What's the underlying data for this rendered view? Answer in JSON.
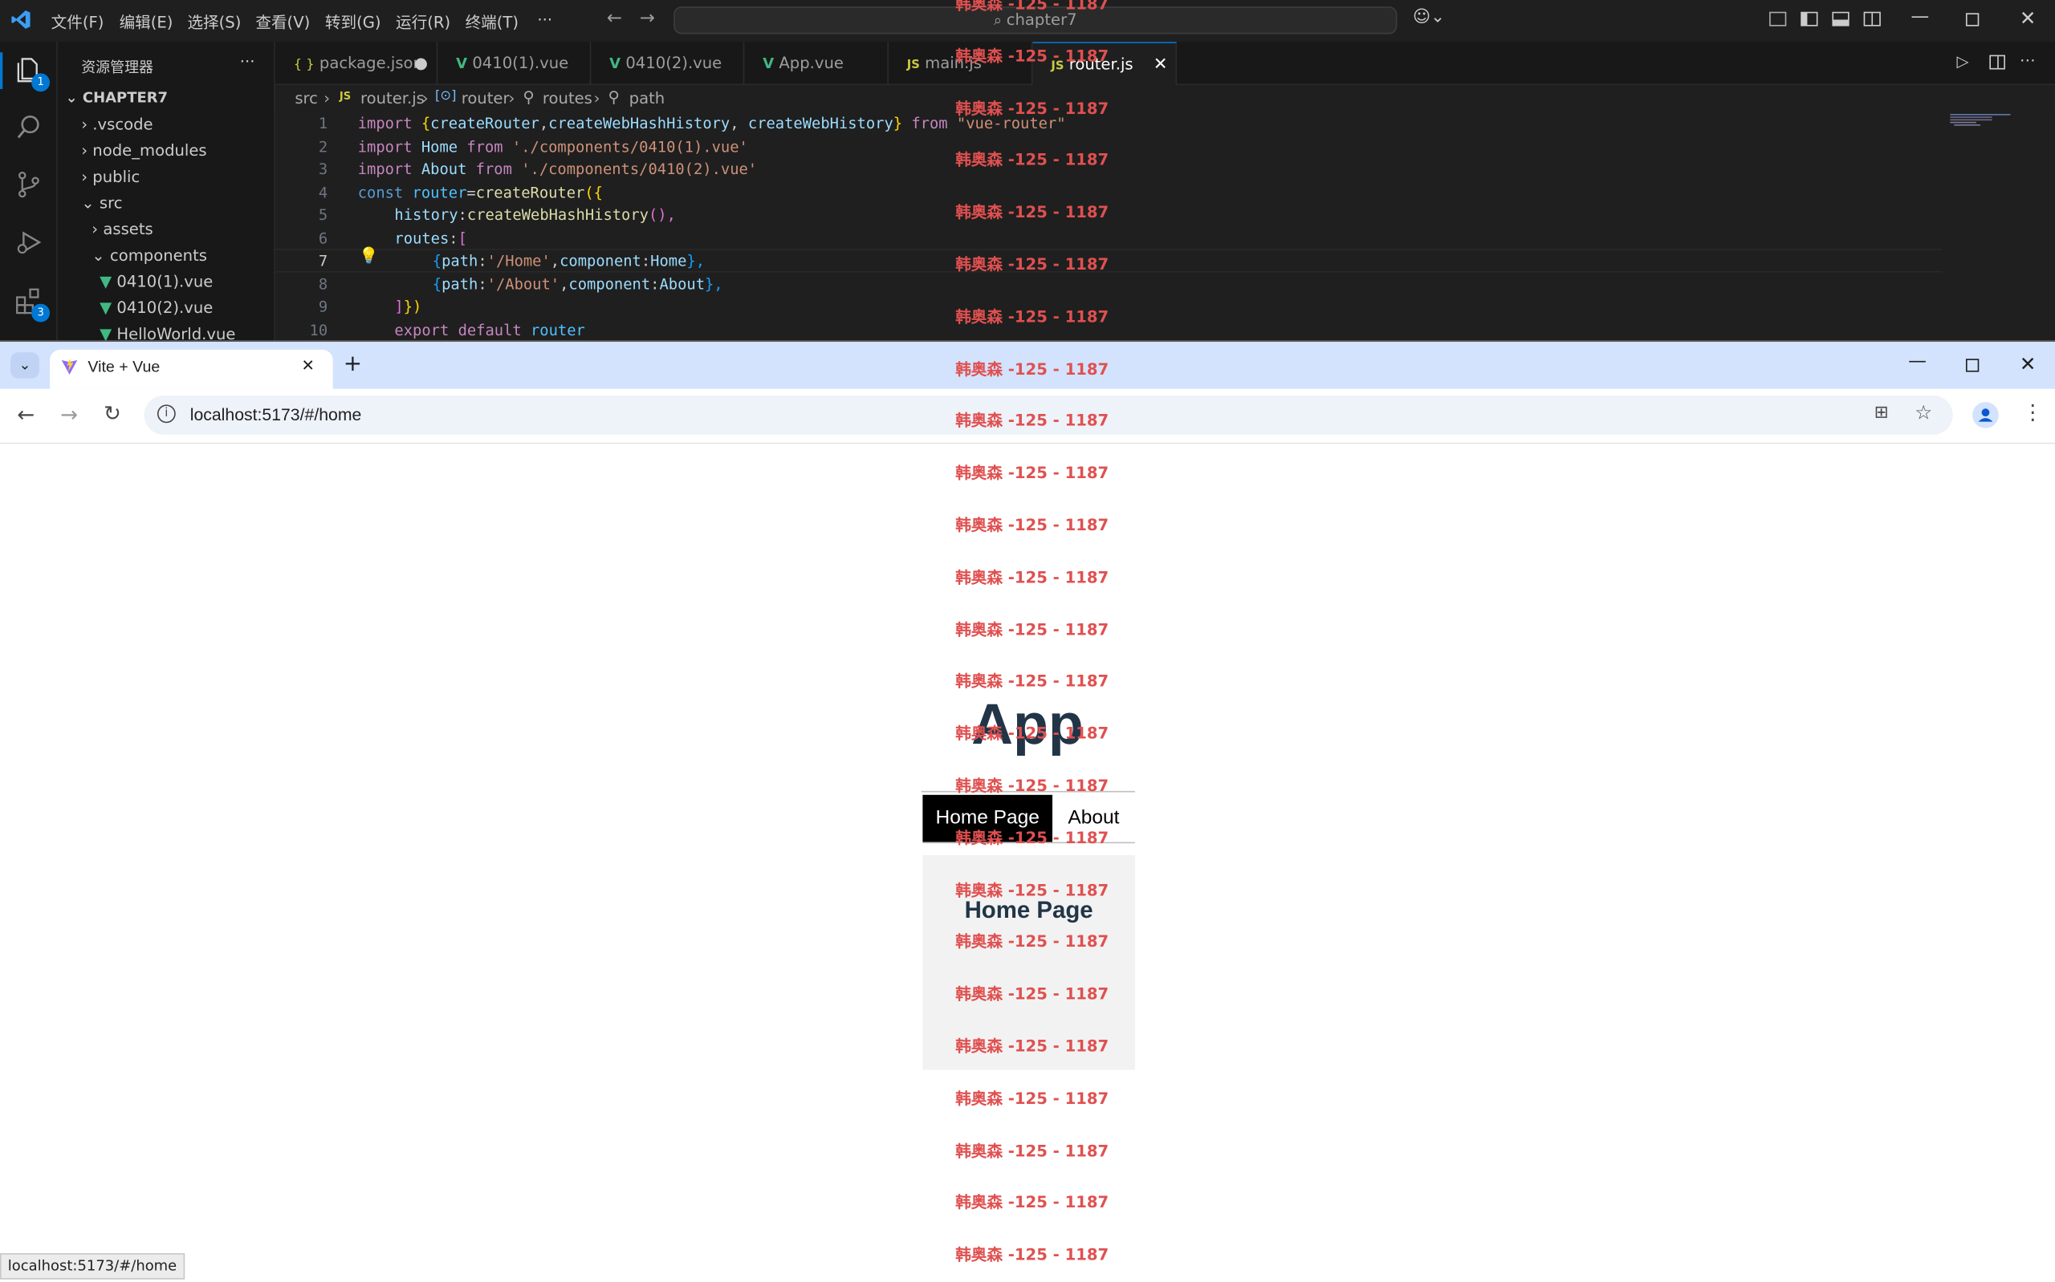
{
  "vscode": {
    "menu": [
      "文件(F)",
      "编辑(E)",
      "选择(S)",
      "查看(V)",
      "转到(G)",
      "运行(R)",
      "终端(T)",
      "···"
    ],
    "search_placeholder": "chapter7",
    "explorer_title": "资源管理器",
    "explorer_more": "···",
    "badges": {
      "explorer": "1",
      "extensions": "3"
    },
    "tree": {
      "root": "CHAPTER7",
      "items": [
        ".vscode",
        "node_modules",
        "public",
        "src",
        "assets",
        "components",
        "0410(1).vue",
        "0410(2).vue",
        "HelloWorld.vue"
      ]
    },
    "tabs": [
      {
        "icon": "{ }",
        "label": "package.json"
      },
      {
        "icon": "V",
        "label": "0410(1).vue"
      },
      {
        "icon": "V",
        "label": "0410(2).vue"
      },
      {
        "icon": "V",
        "label": "App.vue"
      },
      {
        "icon": "JS",
        "label": "main.js"
      },
      {
        "icon": "JS",
        "label": "router.js"
      }
    ],
    "breadcrumb": [
      "src",
      "router.js",
      "router",
      "routes",
      "path"
    ],
    "line_numbers": [
      "1",
      "2",
      "3",
      "4",
      "5",
      "6",
      "7",
      "8",
      "9",
      "10"
    ],
    "code": {
      "l1": {
        "a": "import",
        "b": " {",
        "c": "createRouter",
        "d": ",",
        "e": "createWebHashHistory",
        "f": ", ",
        "g": "createWebHistory",
        "h": "} ",
        "i": "from",
        "j": " \"vue-router\""
      },
      "l2": {
        "a": "import",
        "b": " Home ",
        "c": "from",
        "d": " './components/0410(1).vue'"
      },
      "l3": {
        "a": "import",
        "b": " About ",
        "c": "from",
        "d": " './components/0410(2).vue'"
      },
      "l4": {
        "a": "const",
        "b": " router",
        "c": "=",
        "d": "createRouter",
        "e": "({"
      },
      "l5": {
        "a": "history",
        "b": ":",
        "c": "createWebHashHistory",
        "d": "(),"
      },
      "l6": {
        "a": "routes",
        "b": ":",
        "c": "["
      },
      "l7": {
        "a": "{",
        "b": "path",
        "c": ":",
        "d": "'/Home'",
        "e": ",",
        "f": "component",
        "g": ":",
        "h": "Home",
        "i": "},"
      },
      "l8": {
        "a": "{",
        "b": "path",
        "c": ":",
        "d": "'/About'",
        "e": ",",
        "f": "component",
        "g": ":",
        "h": "About",
        "i": "},"
      },
      "l9": {
        "a": "]",
        "b": "})"
      },
      "l10": {
        "a": "export",
        "b": " default",
        "c": " router"
      }
    }
  },
  "browser": {
    "tab_title": "Vite + Vue",
    "url": "localhost:5173/#/home",
    "status_url": "localhost:5173/#/home"
  },
  "page": {
    "app_title": "App",
    "nav": [
      {
        "label": "Home Page"
      },
      {
        "label": "About"
      }
    ],
    "home_title": "Home Page"
  },
  "watermark": "韩奥森 -125 - 1187",
  "colors": {
    "accent": "#0078d4",
    "watermark": "#e05050"
  }
}
